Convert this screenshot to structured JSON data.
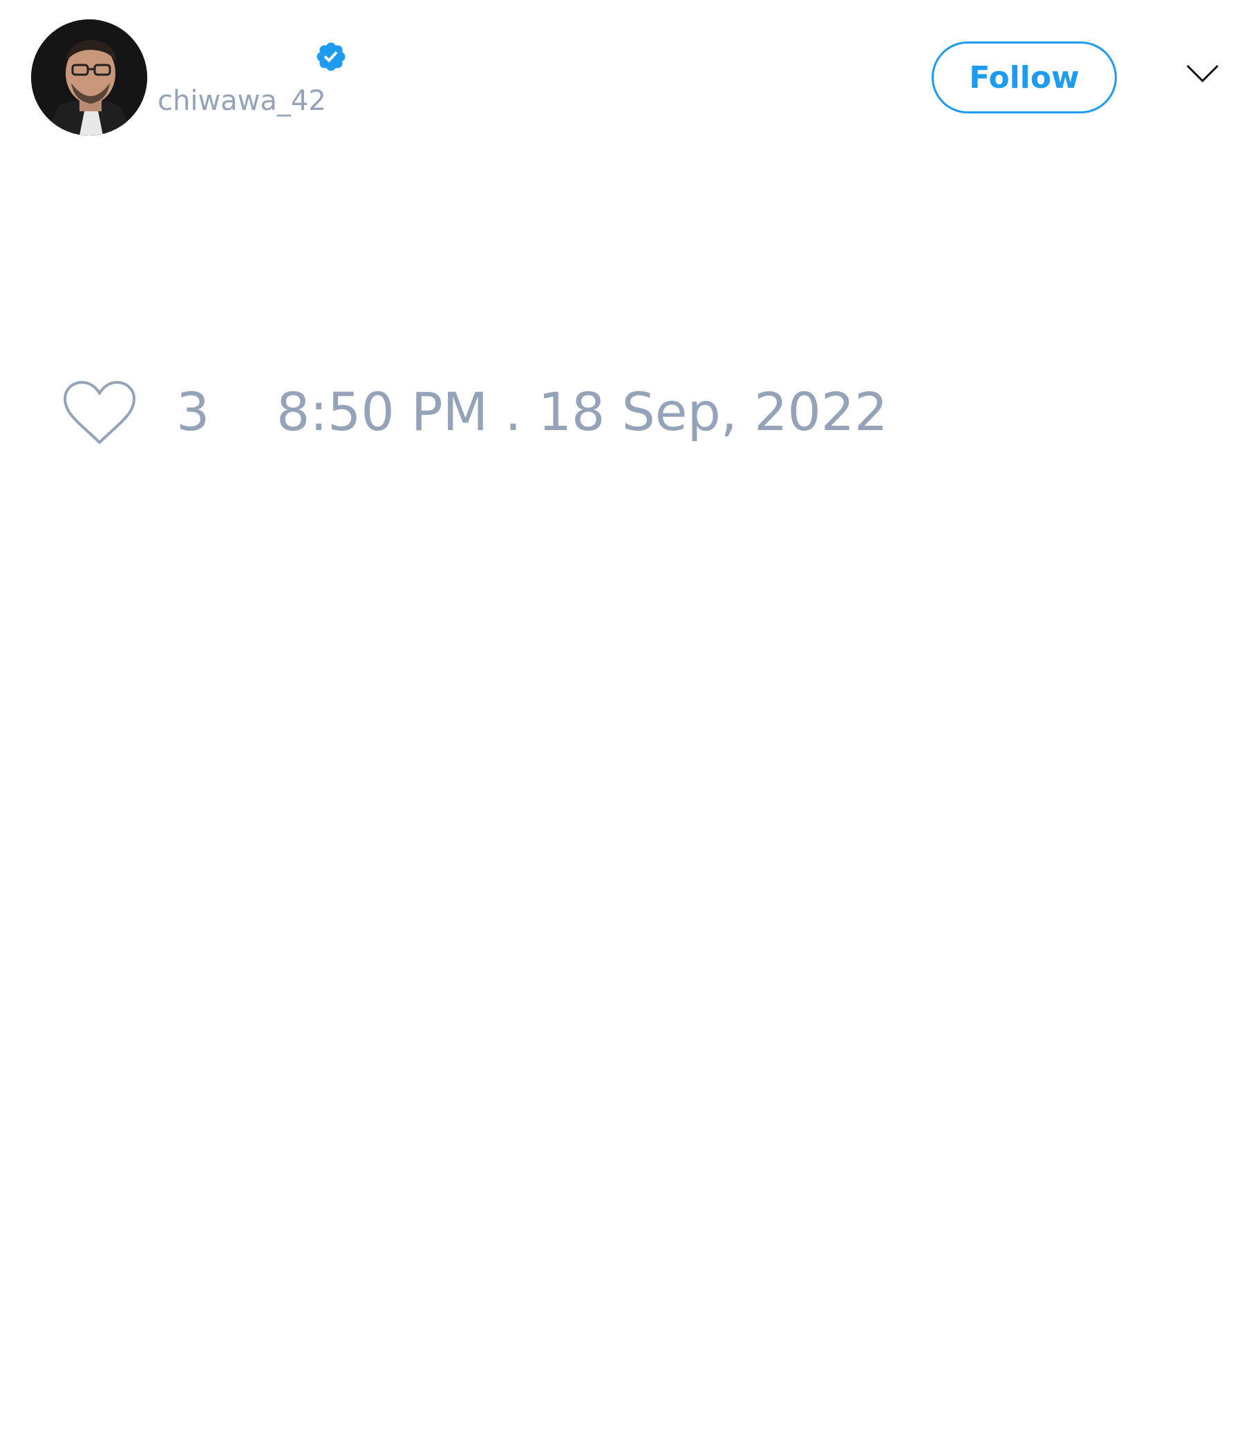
{
  "tweet": {
    "author": {
      "handle": "chiwawa_42",
      "verified": true,
      "avatar": "profile-photo"
    },
    "follow_label": "Follow",
    "menu_icon": "chevron-down-icon",
    "like_icon": "heart-outline-icon",
    "like_count": "3",
    "timestamp": "8:50 PM . 18 Sep, 2022"
  },
  "colors": {
    "accent": "#1d9bf0",
    "muted_text": "#94a3b8",
    "background": "#ffffff"
  }
}
